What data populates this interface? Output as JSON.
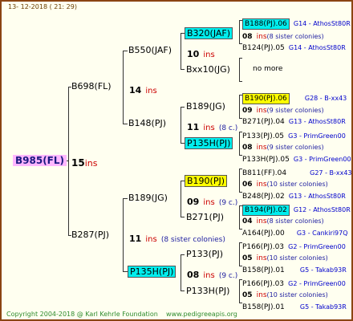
{
  "header": {
    "timestamp": "13- 12-2018 ( 21: 29)"
  },
  "footer": {
    "copyright": "Copyright 2004-2018 @ Karl Kehrle Foundation",
    "site": "www.pedigreeapis.org"
  },
  "colors": {
    "frame": "#8b4513",
    "cyan_highlight": "#00eeee",
    "yellow_highlight": "#ffff00",
    "root_highlight": "#ffb6ff",
    "ins_red": "#cc0000",
    "info_blue": "#0000cc"
  },
  "root": {
    "id": "B985(FL)",
    "count": "15",
    "ins": "ins"
  },
  "gen2": [
    {
      "id": "B698(FL)",
      "count": "14",
      "ins": "ins"
    },
    {
      "id": "B287(PJ)",
      "count": "11",
      "ins": "ins",
      "sisters": "(8 sister colonies)"
    }
  ],
  "gen3": [
    {
      "id": "B550(JAF)",
      "count": "10",
      "ins": "ins"
    },
    {
      "id": "B148(PJ)",
      "count": "11",
      "ins": "ins",
      "sisters": "(8 c.)"
    },
    {
      "id": "B189(JG)",
      "count": "09",
      "ins": "ins",
      "sisters": "(9 c.)"
    },
    {
      "id": "P135H(PJ)",
      "count": "08",
      "ins": "ins",
      "sisters": "(9 c.)"
    }
  ],
  "gen4": [
    {
      "id": "B320(JAF)",
      "count": "08",
      "ins": "ins",
      "sisters": "(8 sister colonies)"
    },
    {
      "id": "Bxx10(JG)"
    },
    {
      "id": "B189(JG)",
      "count": "09",
      "ins": "ins",
      "sisters": "(9 sister colonies)"
    },
    {
      "id": "P135H(PJ)",
      "count": "08",
      "ins": "ins",
      "sisters": "(9 sister colonies)"
    },
    {
      "id": "B190(PJ)",
      "count": "06",
      "ins": "ins",
      "sisters": "(10 sister colonies)"
    },
    {
      "id": "B271(PJ)",
      "count": "04",
      "ins": "ins",
      "sisters": "(8 sister colonies)"
    },
    {
      "id": "P133(PJ)",
      "count": "05",
      "ins": "ins",
      "sisters": "(10 sister colonies)"
    },
    {
      "id": "P133H(PJ)",
      "count": "05",
      "ins": "ins",
      "sisters": "(10 sister colonies)"
    }
  ],
  "gen5": [
    {
      "id": "B188(PJ).06",
      "info": "G14 - AthosSt80R"
    },
    {
      "id": "B124(PJ).05",
      "info": "G14 - AthosSt80R"
    },
    {
      "no_more": "no more"
    },
    {
      "id": "B190(PJ).06",
      "info": "G28 - B-xx43"
    },
    {
      "id": "B271(PJ).04",
      "info": "G13 - AthosSt80R"
    },
    {
      "id": "P133(PJ).05",
      "info": "G3 - PrimGreen00"
    },
    {
      "id": "P133H(PJ).05",
      "info": "G3 - PrimGreen00"
    },
    {
      "id": "B811(FF).04",
      "info": "G27 - B-xx43"
    },
    {
      "id": "B248(PJ).02",
      "info": "G13 - AthosSt80R"
    },
    {
      "id": "B194(PJ).02",
      "info": "G12 - AthosSt80R"
    },
    {
      "id": "A164(PJ).00",
      "info": "G3 - Cankiri97Q"
    },
    {
      "id": "P166(PJ).03",
      "info": "G2 - PrimGreen00"
    },
    {
      "id": "B158(PJ).01",
      "info": "G5 - Takab93R"
    },
    {
      "id": "P166(PJ).03",
      "info": "G2 - PrimGreen00"
    },
    {
      "id": "B158(PJ).01",
      "info": "G5 - Takab93R"
    }
  ]
}
